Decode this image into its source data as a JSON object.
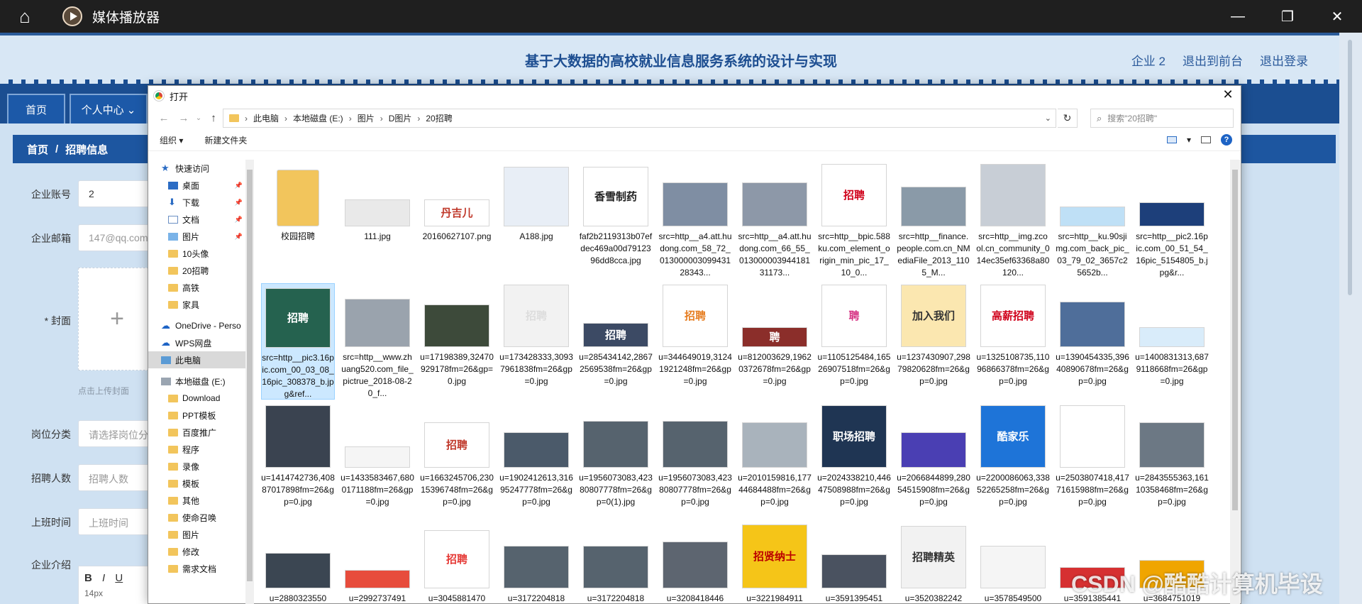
{
  "player": {
    "title": "媒体播放器",
    "home_icon": "home-icon",
    "logo_icon": "play-logo-icon"
  },
  "web": {
    "site_title": "基于大数据的高校就业信息服务系统的设计与实现",
    "header_links": [
      "企业 2",
      "退出到前台",
      "退出登录"
    ],
    "nav_tabs": [
      "首页",
      "个人中心 ⌄"
    ],
    "breadcrumb": {
      "home": "首页",
      "sep": "/",
      "current": "招聘信息"
    },
    "form": {
      "account_label": "企业账号",
      "account_value": "2",
      "email_label": "企业邮箱",
      "email_value": "147@qq.com",
      "cover_label": "* 封面",
      "upload_tip": "点击上传封面",
      "category_label": "岗位分类",
      "category_placeholder": "请选择岗位分类",
      "count_label": "招聘人数",
      "count_placeholder": "招聘人数",
      "time_label": "上班时间",
      "time_placeholder": "上班时间",
      "intro_label": "企业介绍",
      "editor_buttons": [
        "B",
        "I",
        "U"
      ],
      "editor_size": "14px"
    }
  },
  "dialog": {
    "title": "打开",
    "breadcrumb": [
      "此电脑",
      "本地磁盘 (E:)",
      "图片",
      "D图片",
      "20招聘"
    ],
    "search_placeholder": "搜索\"20招聘\"",
    "toolbar": {
      "organize": "组织 ▾",
      "new_folder": "新建文件夹"
    },
    "nav_items": [
      {
        "label": "快速访问",
        "icon": "star-icon",
        "indent": 0
      },
      {
        "label": "桌面",
        "icon": "desktop-icon",
        "indent": 1,
        "pinned": true
      },
      {
        "label": "下载",
        "icon": "download-icon",
        "indent": 1,
        "pinned": true
      },
      {
        "label": "文档",
        "icon": "document-icon",
        "indent": 1,
        "pinned": true
      },
      {
        "label": "图片",
        "icon": "pictures-icon",
        "indent": 1,
        "pinned": true
      },
      {
        "label": "10头像",
        "icon": "folder-icon",
        "indent": 1
      },
      {
        "label": "20招聘",
        "icon": "folder-icon",
        "indent": 1
      },
      {
        "label": "高铁",
        "icon": "folder-icon",
        "indent": 1
      },
      {
        "label": "家具",
        "icon": "folder-icon",
        "indent": 1
      },
      {
        "label": "",
        "icon": "",
        "indent": 0
      },
      {
        "label": "OneDrive - Perso",
        "icon": "cloud-icon",
        "indent": 0
      },
      {
        "label": "WPS网盘",
        "icon": "cloud-icon",
        "indent": 0
      },
      {
        "label": "此电脑",
        "icon": "computer-icon",
        "indent": 0,
        "selected": true
      },
      {
        "label": "",
        "icon": "",
        "indent": 0
      },
      {
        "label": "本地磁盘 (E:)",
        "icon": "disk-icon",
        "indent": 0
      },
      {
        "label": "Download",
        "icon": "folder-icon",
        "indent": 1
      },
      {
        "label": "PPT模板",
        "icon": "folder-icon",
        "indent": 1
      },
      {
        "label": "百度推广",
        "icon": "folder-icon",
        "indent": 1
      },
      {
        "label": "程序",
        "icon": "folder-icon",
        "indent": 1
      },
      {
        "label": "录像",
        "icon": "folder-icon",
        "indent": 1
      },
      {
        "label": "模板",
        "icon": "folder-icon",
        "indent": 1
      },
      {
        "label": "其他",
        "icon": "folder-icon",
        "indent": 1
      },
      {
        "label": "使命召唤",
        "icon": "folder-icon",
        "indent": 1
      },
      {
        "label": "图片",
        "icon": "folder-icon",
        "indent": 1
      },
      {
        "label": "修改",
        "icon": "folder-icon",
        "indent": 1
      },
      {
        "label": "需求文档",
        "icon": "folder-icon",
        "indent": 1
      }
    ],
    "files": [
      {
        "name": "校园招聘",
        "color": "#f2c55c",
        "h": 80,
        "folder": true,
        "text": ""
      },
      {
        "name": "111.jpg",
        "color": "#e9e9e9",
        "h": 38,
        "text": ""
      },
      {
        "name": "20160627107.png",
        "color": "#ffffff",
        "h": 38,
        "text": "丹吉儿",
        "tc": "#c0392b"
      },
      {
        "name": "A188.jpg",
        "color": "#e8eef6",
        "h": 84,
        "text": ""
      },
      {
        "name": "faf2b2119313b07efdec469a00d7912396dd8cca.jpg",
        "color": "#ffffff",
        "h": 84,
        "text": "香雪制药",
        "tc": "#222"
      },
      {
        "name": "src=http__a4.att.hudong.com_58_72_01300000309943128343...",
        "color": "#7f8ea3",
        "h": 62,
        "text": ""
      },
      {
        "name": "src=http__a4.att.hudong.com_66_55_01300000394418131173...",
        "color": "#8d98a8",
        "h": 62,
        "text": ""
      },
      {
        "name": "src=http__bpic.588ku.com_element_origin_min_pic_17_10_0...",
        "color": "#ffffff",
        "h": 88,
        "text": "招聘",
        "tc": "#d0021b"
      },
      {
        "name": "src=http__finance.people.com.cn_NMediaFile_2013_1105_M...",
        "color": "#8a9aa8",
        "h": 56,
        "text": ""
      },
      {
        "name": "src=http__img.zcool.cn_community_014ec35ef63368a80120...",
        "color": "#c8ced6",
        "h": 88,
        "text": ""
      },
      {
        "name": "src=http__ku.90sjimg.com_back_pic_03_79_02_3657c25652b...",
        "color": "#bfe0f6",
        "h": 28,
        "text": ""
      },
      {
        "name": "src=http__pic2.16pic.com_00_51_54_16pic_5154805_b.jpg&r...",
        "color": "#1d3f7a",
        "h": 34,
        "text": ""
      },
      {
        "name": "src=http__pic3.16pic.com_00_03_08_16pic_308378_b.jpg&ref...",
        "color": "#25624f",
        "h": 84,
        "text": "招聘",
        "tc": "#fff",
        "selected": true
      },
      {
        "name": "src=http__www.zhuang520.com_file_pictrue_2018-08-20_f...",
        "color": "#9aa3ad",
        "h": 68,
        "text": ""
      },
      {
        "name": "u=17198389,32470929178fm=26&gp=0.jpg",
        "color": "#3d4a3a",
        "h": 60,
        "text": ""
      },
      {
        "name": "u=173428333,30937961838fm=26&gp=0.jpg",
        "color": "#f2f2f2",
        "h": 88,
        "text": "招聘",
        "tc": "#ddd"
      },
      {
        "name": "u=285434142,28672569538fm=26&gp=0.jpg",
        "color": "#3c4a64",
        "h": 34,
        "text": "招聘",
        "tc": "#fff"
      },
      {
        "name": "u=344649019,31241921248fm=26&gp=0.jpg",
        "color": "#ffffff",
        "h": 88,
        "text": "招聘",
        "tc": "#e67e22"
      },
      {
        "name": "u=812003629,19620372678fm=26&gp=0.jpg",
        "color": "#8b2e2a",
        "h": 28,
        "text": "聘",
        "tc": "#fff"
      },
      {
        "name": "u=1105125484,16526907518fm=26&gp=0.jpg",
        "color": "#ffffff",
        "h": 88,
        "text": "聘",
        "tc": "#d63384"
      },
      {
        "name": "u=1237430907,29879820628fm=26&gp=0.jpg",
        "color": "#fbe7b0",
        "h": 88,
        "text": "加入我们",
        "tc": "#333"
      },
      {
        "name": "u=1325108735,11096866378fm=26&gp=0.jpg",
        "color": "#ffffff",
        "h": 88,
        "text": "高薪招聘",
        "tc": "#d0021b"
      },
      {
        "name": "u=1390454335,39640890678fm=26&gp=0.jpg",
        "color": "#4f6e9a",
        "h": 64,
        "text": ""
      },
      {
        "name": "u=1400831313,6879118668fm=26&gp=0.jpg",
        "color": "#d9ecfa",
        "h": 28,
        "text": ""
      },
      {
        "name": "u=1414742736,40887017898fm=26&gp=0.jpg",
        "color": "#3a4350",
        "h": 88,
        "text": ""
      },
      {
        "name": "u=1433583467,6800171188fm=26&gp=0.jpg",
        "color": "#f5f5f5",
        "h": 30,
        "text": ""
      },
      {
        "name": "u=1663245706,23015396748fm=26&gp=0.jpg",
        "color": "#ffffff",
        "h": 64,
        "text": "招聘",
        "tc": "#c0392b"
      },
      {
        "name": "u=1902412613,31695247778fm=26&gp=0.jpg",
        "color": "#4b5a6a",
        "h": 50,
        "text": ""
      },
      {
        "name": "u=1956073083,42380807778fm=26&gp=0(1).jpg",
        "color": "#56636e",
        "h": 66,
        "text": ""
      },
      {
        "name": "u=1956073083,42380807778fm=26&gp=0.jpg",
        "color": "#56636e",
        "h": 66,
        "text": ""
      },
      {
        "name": "u=2010159816,17744684488fm=26&gp=0.jpg",
        "color": "#a9b3bc",
        "h": 64,
        "text": ""
      },
      {
        "name": "u=2024338210,44647508988fm=26&gp=0.jpg",
        "color": "#1f3553",
        "h": 88,
        "text": "职场招聘",
        "tc": "#fff"
      },
      {
        "name": "u=2066844899,28054515908fm=26&gp=0.jpg",
        "color": "#4a3fb3",
        "h": 50,
        "text": ""
      },
      {
        "name": "u=2200086063,33852265258fm=26&gp=0.jpg",
        "color": "#1e74d8",
        "h": 88,
        "text": "酷家乐",
        "tc": "#fff"
      },
      {
        "name": "u=2503807418,41771615988fm=26&gp=0.jpg",
        "color": "#ffffff",
        "h": 88,
        "text": "",
        "tc": "#333"
      },
      {
        "name": "u=2843555363,16110358468fm=26&gp=0.jpg",
        "color": "#6c7884",
        "h": 64,
        "text": ""
      },
      {
        "name": "u=2880323550",
        "color": "#3b4652",
        "h": 50,
        "text": ""
      },
      {
        "name": "u=2992737491",
        "color": "#e74c3c",
        "h": 26,
        "text": ""
      },
      {
        "name": "u=3045881470",
        "color": "#ffffff",
        "h": 82,
        "text": "招聘",
        "tc": "#e53935"
      },
      {
        "name": "u=3172204818",
        "color": "#56636e",
        "h": 60,
        "text": ""
      },
      {
        "name": "u=3172204818",
        "color": "#56636e",
        "h": 60,
        "text": ""
      },
      {
        "name": "u=3208418446",
        "color": "#5d6570",
        "h": 66,
        "text": ""
      },
      {
        "name": "u=3221984911",
        "color": "#f5c518",
        "h": 90,
        "text": "招贤纳士",
        "tc": "#b00"
      },
      {
        "name": "u=3591395451",
        "color": "#4a5260",
        "h": 48,
        "text": ""
      },
      {
        "name": "u=3520382242",
        "color": "#f2f2f2",
        "h": 88,
        "text": "招聘精英",
        "tc": "#333"
      },
      {
        "name": "u=3578549500",
        "color": "#f5f5f5",
        "h": 60,
        "text": ""
      },
      {
        "name": "u=3591385441",
        "color": "#d63031",
        "h": 30,
        "text": ""
      },
      {
        "name": "u=3684751019",
        "color": "#f0a500",
        "h": 40,
        "text": ""
      }
    ]
  },
  "watermark": "CSDN @酷酷计算机毕设"
}
